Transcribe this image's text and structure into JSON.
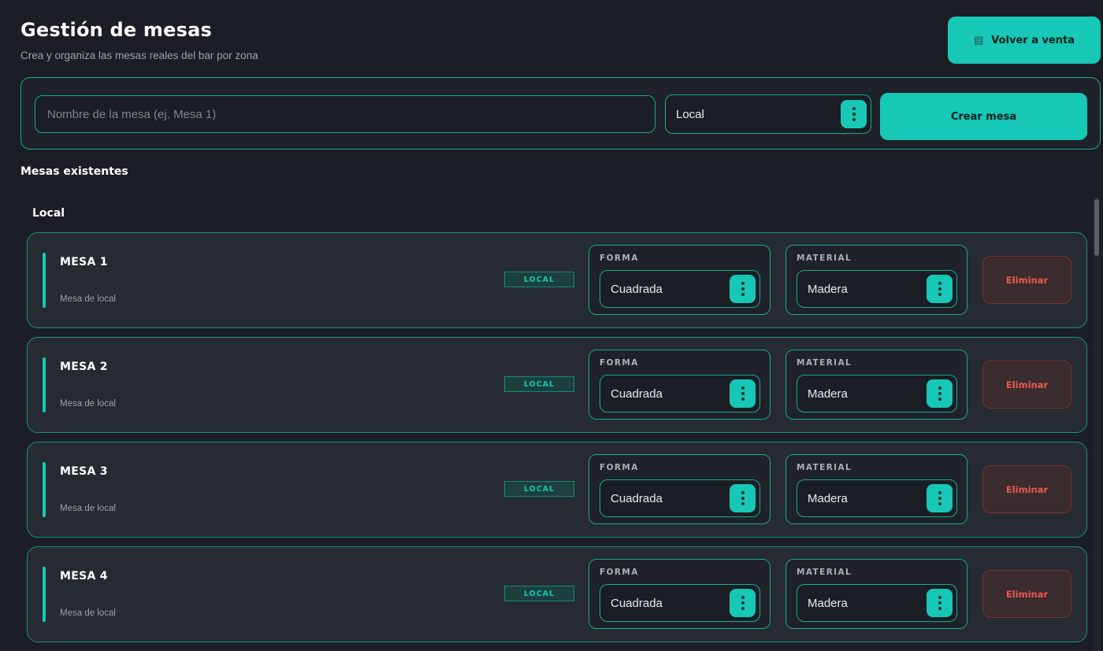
{
  "header": {
    "title": "Gestión de mesas",
    "subtitle": "Crea y organiza las mesas reales del bar por zona",
    "back_button": {
      "icon": "register-icon",
      "label": "Volver a venta"
    }
  },
  "create_form": {
    "name_placeholder": "Nombre de la mesa (ej. Mesa 1)",
    "name_value": "",
    "zone_selected": "Local",
    "create_label": "Crear mesa"
  },
  "existing_title": "Mesas existentes",
  "zone": {
    "title": "Local",
    "tables": [
      {
        "name": "MESA 1",
        "description": "Mesa de local",
        "badge": "LOCAL",
        "forma_label": "FORMA",
        "forma": "Cuadrada",
        "material_label": "MATERIAL",
        "material": "Madera",
        "delete_label": "Eliminar"
      },
      {
        "name": "MESA 2",
        "description": "Mesa de local",
        "badge": "LOCAL",
        "forma_label": "FORMA",
        "forma": "Cuadrada",
        "material_label": "MATERIAL",
        "material": "Madera",
        "delete_label": "Eliminar"
      },
      {
        "name": "MESA 3",
        "description": "Mesa de local",
        "badge": "LOCAL",
        "forma_label": "FORMA",
        "forma": "Cuadrada",
        "material_label": "MATERIAL",
        "material": "Madera",
        "delete_label": "Eliminar"
      },
      {
        "name": "MESA 4",
        "description": "Mesa de local",
        "badge": "LOCAL",
        "forma_label": "FORMA",
        "forma": "Cuadrada",
        "material_label": "MATERIAL",
        "material": "Madera",
        "delete_label": "Eliminar"
      }
    ]
  },
  "colors": {
    "accent": "#16c8b5",
    "background": "#1b1e24",
    "card": "#262a31",
    "danger": "#ec5a4e"
  }
}
